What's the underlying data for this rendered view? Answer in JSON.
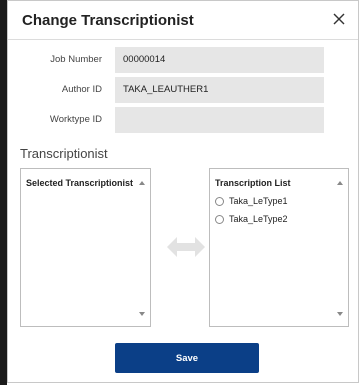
{
  "dialog": {
    "title": "Change Transcriptionist",
    "close_icon": "close-icon"
  },
  "form": {
    "job_number": {
      "label": "Job Number",
      "value": "00000014"
    },
    "author_id": {
      "label": "Author ID",
      "value": "TAKA_LEAUTHER1"
    },
    "worktype_id": {
      "label": "Worktype ID",
      "value": ""
    }
  },
  "transcriptionist": {
    "section_title": "Transcriptionist",
    "selected_list": {
      "header": "Selected Transcriptionist",
      "items": []
    },
    "available_list": {
      "header": "Transcription List",
      "items": [
        {
          "label": "Taka_LeType1",
          "checked": false
        },
        {
          "label": "Taka_LeType2",
          "checked": false
        }
      ]
    },
    "transfer_icon": "left-right-arrows-icon"
  },
  "actions": {
    "save_label": "Save"
  },
  "colors": {
    "primary_button": "#0b3f87",
    "field_background": "#e6e6e6",
    "transfer_arrows": "#e2e2e2"
  }
}
